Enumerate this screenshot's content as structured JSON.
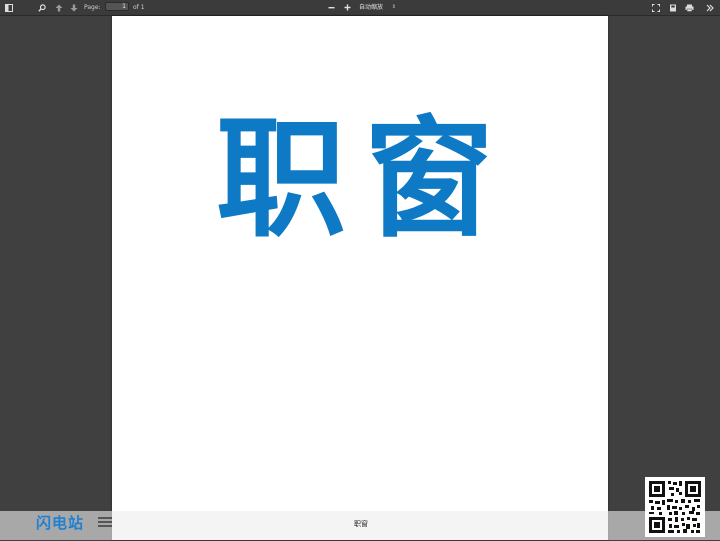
{
  "toolbar": {
    "page_label": "Page:",
    "page_value": "1",
    "page_count": "of 1",
    "zoom_value": "自动缩放",
    "icons": [
      "sidebar-toggle-icon",
      "search-icon",
      "previous-page-icon",
      "next-page-icon",
      "zoom-out-icon",
      "zoom-in-icon",
      "presentation-mode-icon",
      "download-icon",
      "print-icon",
      "more-tools-icon"
    ]
  },
  "document": {
    "title_text": "职窗",
    "title_color": "#0e79c5"
  },
  "footer": {
    "brand_text": "闪电站",
    "brand_color": "#1f7fd1",
    "center_text": "职窗"
  }
}
